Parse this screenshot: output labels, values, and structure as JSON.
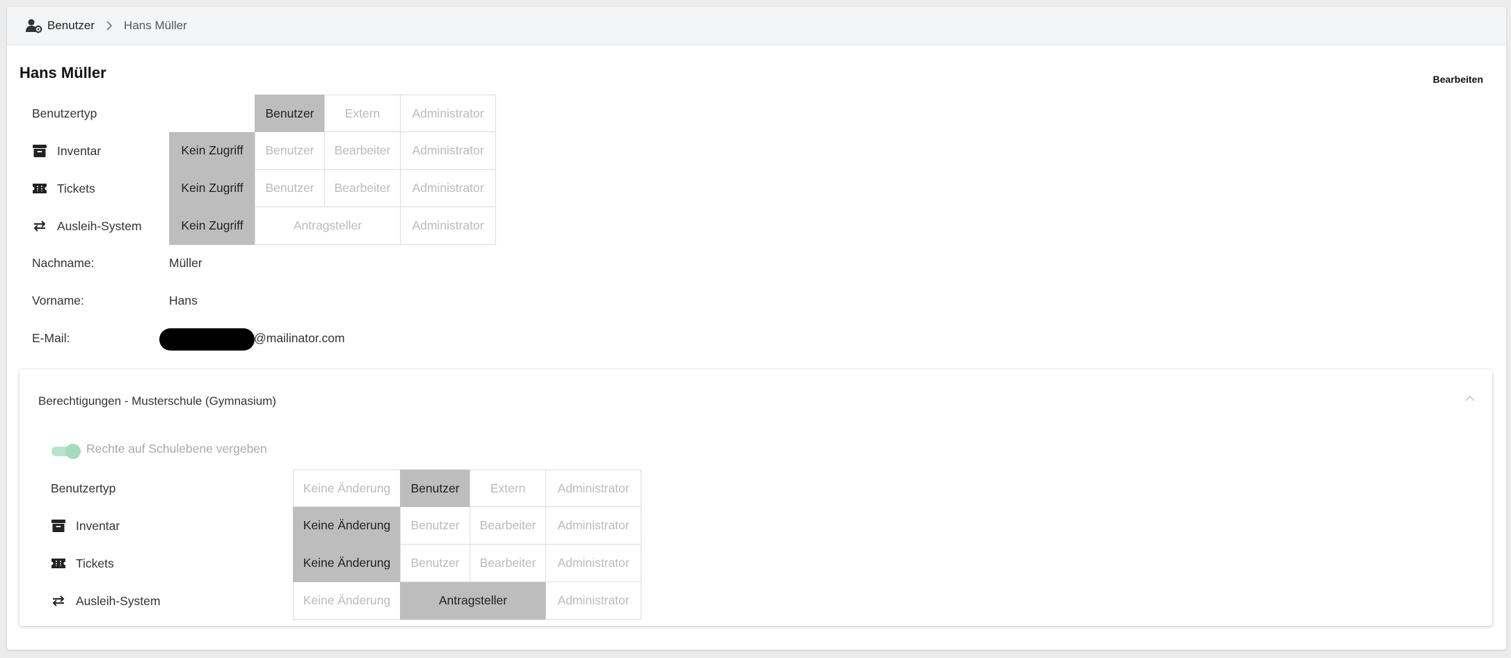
{
  "breadcrumb": {
    "root": "Benutzer",
    "current": "Hans Müller"
  },
  "page": {
    "title": "Hans Müller",
    "edit_label": "Bearbeiten"
  },
  "roles": {
    "user_type": {
      "label": "Benutzertyp",
      "options": [
        "Benutzer",
        "Extern",
        "Administrator"
      ],
      "selected": "Benutzer"
    },
    "inventory": {
      "label": "Inventar",
      "options": [
        "Kein Zugriff",
        "Benutzer",
        "Bearbeiter",
        "Administrator"
      ],
      "selected": "Kein Zugriff"
    },
    "tickets": {
      "label": "Tickets",
      "options": [
        "Kein Zugriff",
        "Benutzer",
        "Bearbeiter",
        "Administrator"
      ],
      "selected": "Kein Zugriff"
    },
    "lending": {
      "label": "Ausleih-System",
      "options": [
        "Kein Zugriff",
        "Antragsteller",
        "Administrator"
      ],
      "selected": "Kein Zugriff"
    }
  },
  "fields": {
    "lastname_label": "Nachname:",
    "lastname": "Müller",
    "firstname_label": "Vorname:",
    "firstname": "Hans",
    "email_label": "E-Mail:",
    "email_domain": "@mailinator.com"
  },
  "permissions": {
    "title": "Berechtigungen - Musterschule (Gymnasium)",
    "toggle_label": "Rechte auf Schulebene vergeben",
    "toggle_on": true,
    "user_type": {
      "label": "Benutzertyp",
      "options": [
        "Keine Änderung",
        "Benutzer",
        "Extern",
        "Administrator"
      ],
      "selected": "Benutzer"
    },
    "inventory": {
      "label": "Inventar",
      "options": [
        "Keine Änderung",
        "Benutzer",
        "Bearbeiter",
        "Administrator"
      ],
      "selected": "Keine Änderung"
    },
    "tickets": {
      "label": "Tickets",
      "options": [
        "Keine Änderung",
        "Benutzer",
        "Bearbeiter",
        "Administrator"
      ],
      "selected": "Keine Änderung"
    },
    "lending": {
      "label": "Ausleih-System",
      "options": [
        "Keine Änderung",
        "Antragsteller",
        "Administrator"
      ],
      "selected": "Antragsteller"
    }
  },
  "colors": {
    "selected_bg": "#bdbdbd",
    "toggle_track": "#b8e3cd",
    "toggle_knob": "#a4dcbf"
  },
  "icons": {
    "breadcrumb": "user-cog-icon",
    "chevron": "chevron-right-icon",
    "inventory": "archive-box-icon",
    "tickets": "ticket-icon",
    "lending": "swap-arrows-icon",
    "collapse": "chevron-up-icon"
  }
}
